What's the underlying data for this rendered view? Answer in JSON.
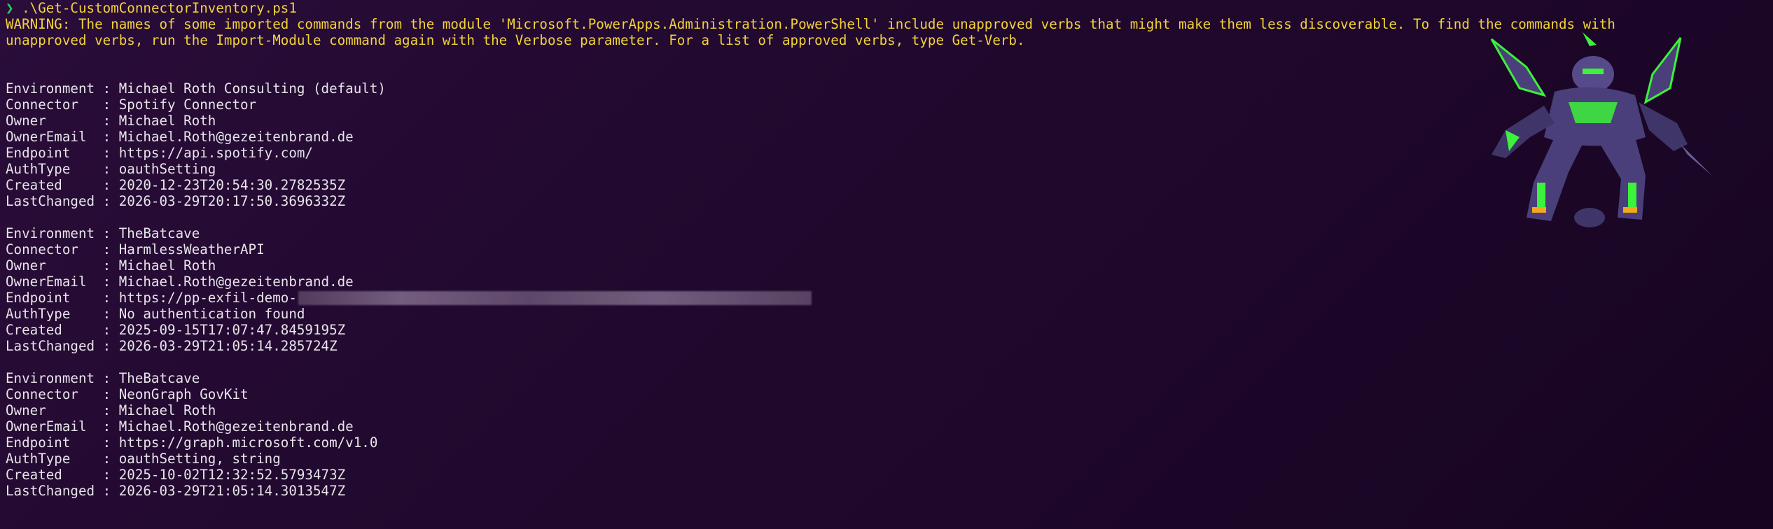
{
  "prompt": {
    "chevron": "❯",
    "command": " .\\Get-CustomConnectorInventory.ps1"
  },
  "warning": {
    "line1": "WARNING: The names of some imported commands from the module 'Microsoft.PowerApps.Administration.PowerShell' include unapproved verbs that might make them less discoverable. To find the commands with",
    "line2": "unapproved verbs, run the Import-Module command again with the Verbose parameter. For a list of approved verbs, type Get-Verb."
  },
  "records": [
    {
      "environment": "Environment : Michael Roth Consulting (default)",
      "connector": "Connector   : Spotify Connector",
      "owner": "Owner       : Michael Roth",
      "owneremail": "OwnerEmail  : Michael.Roth@gezeitenbrand.de",
      "endpoint": "Endpoint    : https://api.spotify.com/",
      "authtype": "AuthType    : oauthSetting",
      "created": "Created     : 2020-12-23T20:54:30.2782535Z",
      "lastchanged": "LastChanged : 2026-03-29T20:17:50.3696332Z"
    },
    {
      "environment": "Environment : TheBatcave",
      "connector": "Connector   : HarmlessWeatherAPI",
      "owner": "Owner       : Michael Roth",
      "owneremail": "OwnerEmail  : Michael.Roth@gezeitenbrand.de",
      "endpoint": "Endpoint    : https://pp-exfil-demo-",
      "authtype": "AuthType    : No authentication found",
      "created": "Created     : 2025-09-15T17:07:47.8459195Z",
      "lastchanged": "LastChanged : 2026-03-29T21:05:14.285724Z"
    },
    {
      "environment": "Environment : TheBatcave",
      "connector": "Connector   : NeonGraph GovKit",
      "owner": "Owner       : Michael Roth",
      "owneremail": "OwnerEmail  : Michael.Roth@gezeitenbrand.de",
      "endpoint": "Endpoint    : https://graph.microsoft.com/v1.0",
      "authtype": "AuthType    : oauthSetting, string",
      "created": "Created     : 2025-10-02T12:32:52.5793473Z",
      "lastchanged": "LastChanged : 2026-03-29T21:05:14.3013547Z"
    }
  ],
  "decoration": {
    "mascot_icon": "mecha-robot-icon",
    "colors": {
      "background": "#22092f",
      "warning_text": "#f2d338",
      "prompt_chevron": "#28d05a",
      "body_text": "#e8e4ea",
      "mascot_body": "#4a3f7a",
      "mascot_accent": "#3cf23a"
    }
  }
}
